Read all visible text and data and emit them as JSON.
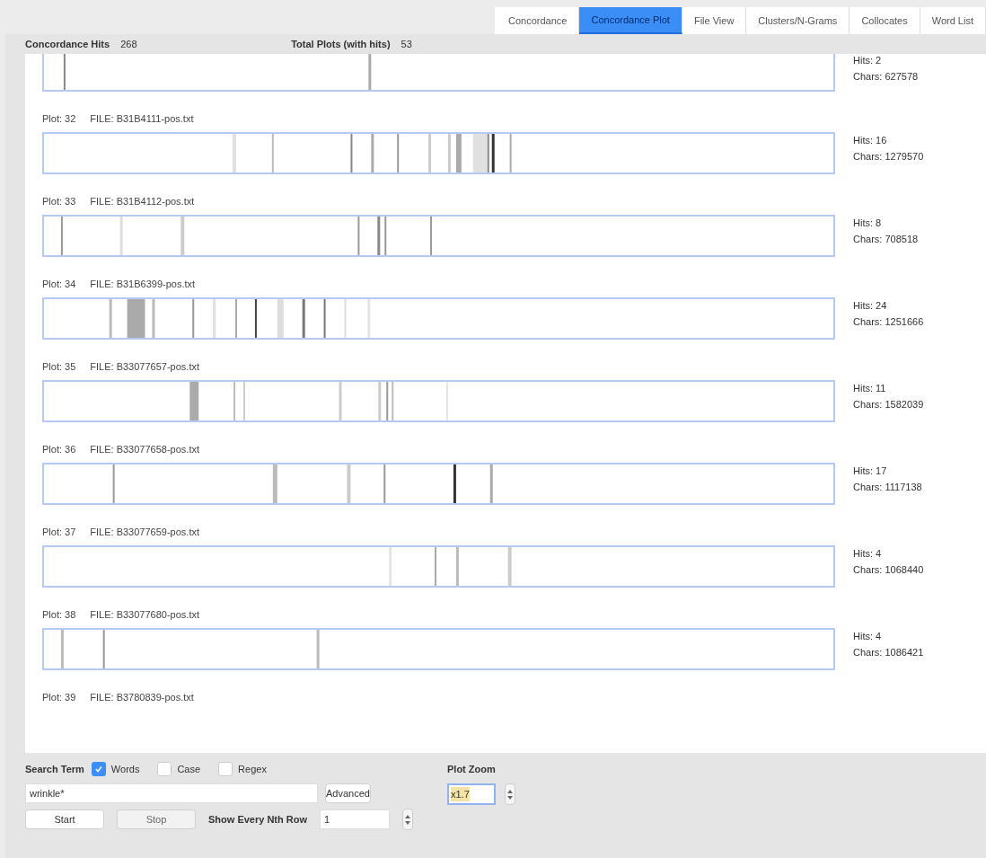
{
  "tabs": [
    {
      "label": "Concordance",
      "selected": false
    },
    {
      "label": "Concordance Plot",
      "selected": true
    },
    {
      "label": "File View",
      "selected": false
    },
    {
      "label": "Clusters/N-Grams",
      "selected": false
    },
    {
      "label": "Collocates",
      "selected": false
    },
    {
      "label": "Word List",
      "selected": false
    }
  ],
  "summary": {
    "hits_label": "Concordance Hits",
    "hits": "268",
    "plots_label": "Total Plots (with hits)",
    "plots": "53"
  },
  "plots": [
    {
      "kind": "partial",
      "hits": "Hits: 2",
      "chars": "Chars: 627578"
    },
    {
      "kind": "full",
      "plot": "Plot: 32",
      "file": "FILE: B31B4111-pos.txt",
      "hits": "Hits: 16",
      "chars": "Chars: 1279570"
    },
    {
      "kind": "full",
      "plot": "Plot: 33",
      "file": "FILE: B31B4112-pos.txt",
      "hits": "Hits: 8",
      "chars": "Chars: 708518"
    },
    {
      "kind": "full",
      "plot": "Plot: 34",
      "file": "FILE: B31B6399-pos.txt",
      "hits": "Hits: 24",
      "chars": "Chars: 1251666"
    },
    {
      "kind": "full",
      "plot": "Plot: 35",
      "file": "FILE: B33077657-pos.txt",
      "hits": "Hits: 11",
      "chars": "Chars: 1582039"
    },
    {
      "kind": "full",
      "plot": "Plot: 36",
      "file": "FILE: B33077658-pos.txt",
      "hits": "Hits: 17",
      "chars": "Chars: 1117138"
    },
    {
      "kind": "full",
      "plot": "Plot: 37",
      "file": "FILE: B33077659-pos.txt",
      "hits": "Hits: 4",
      "chars": "Chars: 1068440"
    },
    {
      "kind": "full",
      "plot": "Plot: 38",
      "file": "FILE: B33077680-pos.txt",
      "hits": "Hits: 4",
      "chars": "Chars: 1086421"
    },
    {
      "kind": "header",
      "plot": "Plot: 39",
      "file": "FILE: B3780839-pos.txt"
    }
  ],
  "search": {
    "label": "Search Term",
    "options": [
      {
        "label": "Words",
        "checked": true
      },
      {
        "label": "Case",
        "checked": false
      },
      {
        "label": "Regex",
        "checked": false
      }
    ],
    "value": "wrinkle*",
    "advanced": "Advanced",
    "start": "Start",
    "stop": "Stop",
    "nth_label": "Show Every Nth Row",
    "nth": "1"
  },
  "zoom": {
    "label": "Plot Zoom",
    "value": "x1.7"
  }
}
